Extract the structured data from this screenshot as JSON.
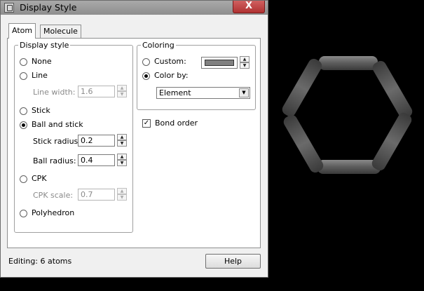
{
  "window": {
    "title": "Display Style",
    "close_glyph": "X"
  },
  "tabs": [
    {
      "label": "Atom",
      "active": true
    },
    {
      "label": "Molecule",
      "active": false
    }
  ],
  "display_style": {
    "legend": "Display style",
    "none_label": "None",
    "line_label": "Line",
    "line_width_label": "Line width:",
    "line_width_value": "1.6",
    "stick_label": "Stick",
    "ball_and_stick_label": "Ball and stick",
    "stick_radius_label": "Stick radius:",
    "stick_radius_value": "0.2",
    "ball_radius_label": "Ball radius:",
    "ball_radius_value": "0.4",
    "cpk_label": "CPK",
    "cpk_scale_label": "CPK scale:",
    "cpk_scale_value": "0.7",
    "polyhedron_label": "Polyhedron",
    "selected": "Ball and stick"
  },
  "coloring": {
    "legend": "Coloring",
    "custom_label": "Custom:",
    "custom_color": "#808080",
    "color_by_label": "Color by:",
    "color_by_value": "Element",
    "selected": "Color by:"
  },
  "bond_order": {
    "label": "Bond order",
    "checked": true
  },
  "footer": {
    "status": "Editing: 6 atoms",
    "help_label": "Help"
  },
  "viewport": {
    "molecule": "hexagonal ring of 6 bonds",
    "bond_color": "#606060",
    "background": "#000000"
  }
}
